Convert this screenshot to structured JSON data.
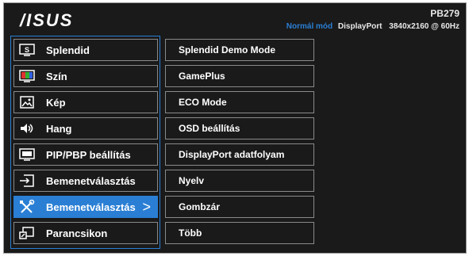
{
  "header": {
    "brand": "/ISUS",
    "model": "PB279",
    "status_mode": "Normál mód",
    "status_source": "DisplayPort",
    "status_resolution": "3840x2160 @ 60Hz"
  },
  "colors": {
    "accent": "#2a7fd4",
    "background": "#1a1a1a"
  },
  "main_menu": [
    {
      "label": "Splendid",
      "icon": "splendid-icon"
    },
    {
      "label": "Szín",
      "icon": "color-icon"
    },
    {
      "label": "Kép",
      "icon": "image-icon"
    },
    {
      "label": "Hang",
      "icon": "speaker-icon"
    },
    {
      "label": "PIP/PBP beállítás",
      "icon": "pip-icon"
    },
    {
      "label": "Bemenetválasztás",
      "icon": "input-icon"
    },
    {
      "label": "Bemenetválasztás",
      "icon": "tools-icon",
      "chevron": ">"
    },
    {
      "label": "Parancsikon",
      "icon": "shortcut-icon"
    }
  ],
  "selected_index": 6,
  "sub_menu": [
    "Splendid Demo Mode",
    "GamePlus",
    "ECO Mode",
    "OSD beállítás",
    "DisplayPort adatfolyam",
    "Nyelv",
    "Gombzár",
    "Több"
  ]
}
